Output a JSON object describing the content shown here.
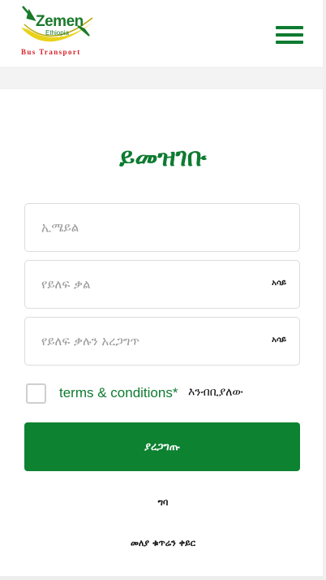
{
  "header": {
    "logo": {
      "brand": "Zemen",
      "sub": "Ethiopia",
      "tagline": "Bus Transport",
      "colors": {
        "green": "#1a7a2a",
        "yellow": "#e9d21a",
        "red": "#d8212a"
      }
    },
    "menu_icon": "hamburger-menu-icon"
  },
  "form": {
    "title": "ይመዝገቡ",
    "email": {
      "placeholder": "ኢሜይል",
      "value": ""
    },
    "password": {
      "placeholder": "የይለፍ ቃል",
      "value": "",
      "toggle_label": "አሳይ"
    },
    "password_confirm": {
      "placeholder": "የይለፍ ቃሉን አረጋግጥ",
      "value": "",
      "toggle_label": "አሳይ"
    },
    "terms": {
      "checked": false,
      "link_text": "terms & conditions*",
      "suffix": "እንብቢያለው"
    },
    "submit_label": "ያረጋግጡ"
  },
  "links": {
    "login": "ግባ",
    "reset_code": "መለያ ቁጥሬን ቀይር"
  },
  "colors": {
    "primary_green": "#0d8231",
    "title_green": "#0d7b30",
    "border": "#dcdcdc"
  }
}
